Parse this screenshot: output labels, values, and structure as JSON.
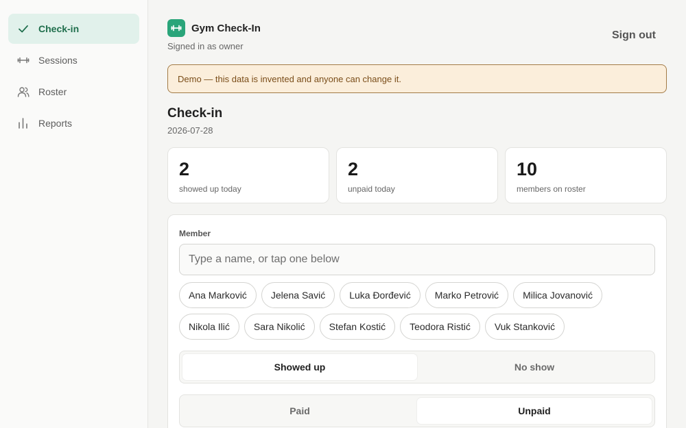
{
  "sidebar": {
    "items": [
      {
        "label": "Check-in",
        "icon": "check-icon",
        "active": true
      },
      {
        "label": "Sessions",
        "icon": "dumbbell-icon",
        "active": false
      },
      {
        "label": "Roster",
        "icon": "users-icon",
        "active": false
      },
      {
        "label": "Reports",
        "icon": "bar-chart-icon",
        "active": false
      }
    ]
  },
  "header": {
    "app_title": "Gym Check-In",
    "signed_in_text": "Signed in as owner",
    "sign_out_label": "Sign out",
    "logo_icon": "dumbbell-icon"
  },
  "banner": {
    "text": "Demo — this data is invented and anyone can change it."
  },
  "page": {
    "title": "Check-in",
    "date": "2026-07-28"
  },
  "stats": [
    {
      "value": "2",
      "label": "showed up today"
    },
    {
      "value": "2",
      "label": "unpaid today"
    },
    {
      "value": "10",
      "label": "members on roster"
    }
  ],
  "form": {
    "member_label": "Member",
    "member_value": "",
    "member_placeholder": "Type a name, or tap one below",
    "members": [
      "Ana Marković",
      "Jelena Savić",
      "Luka Đorđević",
      "Marko Petrović",
      "Milica Jovanović",
      "Nikola Ilić",
      "Sara Nikolić",
      "Stefan Kostić",
      "Teodora Ristić",
      "Vuk Stanković"
    ],
    "attendance": {
      "options": [
        "Showed up",
        "No show"
      ],
      "selected": "Showed up"
    },
    "payment": {
      "options": [
        "Paid",
        "Unpaid"
      ],
      "selected": "Unpaid"
    }
  },
  "colors": {
    "accent": "#2aa57a",
    "active_nav_bg": "#e1f1eb",
    "active_nav_text": "#1f6e4c",
    "banner_bg": "#fbeedb",
    "banner_border": "#a27a45",
    "banner_text": "#7a4d19"
  }
}
